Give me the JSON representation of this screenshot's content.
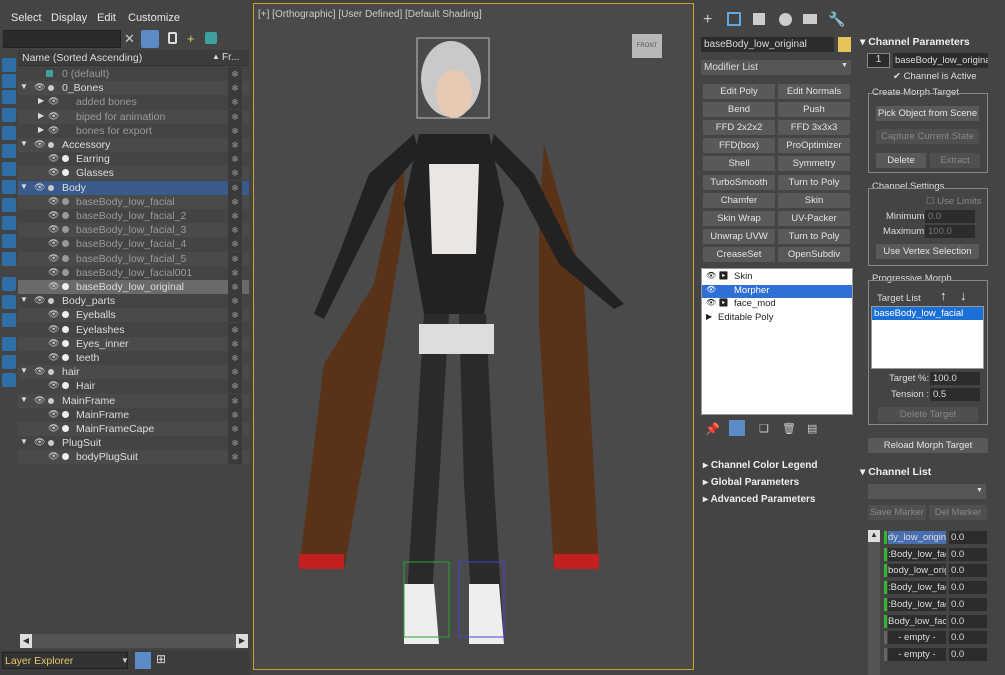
{
  "menu": {
    "select": "Select",
    "display": "Display",
    "edit": "Edit",
    "customize": "Customize"
  },
  "scene": {
    "header_name": "Name (Sorted Ascending)",
    "header_col": "Fr...",
    "rows": [
      "0 (default)",
      "0_Bones",
      "added bones",
      "biped for animation",
      "bones for export",
      "Accessory",
      "Earring",
      "Glasses",
      "Body",
      "baseBody_low_facial",
      "baseBody_low_facial_2",
      "baseBody_low_facial_3",
      "baseBody_low_facial_4",
      "baseBody_low_facial_5",
      "baseBody_low_facial001",
      "baseBody_low_original",
      "Body_parts",
      "Eyeballs",
      "Eyelashes",
      "Eyes_inner",
      "teeth",
      "hair",
      "Hair",
      "MainFrame",
      "MainFrame",
      "MainFrameCape",
      "PlugSuit",
      "bodyPlugSuit"
    ],
    "explorer": "Layer Explorer"
  },
  "viewport": {
    "label": "[+] [Orthographic] [User Defined] [Default Shading]",
    "cube": "FRONT"
  },
  "modify": {
    "object_name": "baseBody_low_original",
    "modifier_list": "Modifier List",
    "buttons": [
      "Edit Poly",
      "Edit Normals",
      "Bend",
      "Push",
      "FFD 2x2x2",
      "FFD 3x3x3",
      "FFD(box)",
      "ProOptimizer",
      "Shell",
      "Symmetry",
      "TurboSmooth",
      "Turn to Poly",
      "Chamfer",
      "Skin",
      "Skin Wrap",
      "UV-Packer",
      "Unwrap UVW",
      "Turn to Poly",
      "CreaseSet",
      "OpenSubdiv"
    ],
    "stack": [
      "Skin",
      "Morpher",
      "face_mod",
      "Editable Poly"
    ],
    "rollouts": [
      "Channel Color Legend",
      "Global Parameters",
      "Advanced Parameters"
    ]
  },
  "channel": {
    "title": "Channel Parameters",
    "index": "1",
    "name": "baseBody_low_original_",
    "active": "Channel is Active",
    "create_title": "Create Morph Target",
    "pick": "Pick Object from Scene",
    "capture": "Capture Current State",
    "delete": "Delete",
    "extract": "Extract",
    "settings_title": "Channel Settings",
    "use_limits": "Use Limits",
    "min_lbl": "Minimum :",
    "min_val": "0.0",
    "max_lbl": "Maximum :",
    "max_val": "100.0",
    "vertex_sel": "Use Vertex Selection",
    "prog_title": "Progressive Morph",
    "target_list": "Target List",
    "target_item": "baseBody_low_facial",
    "target_pct_lbl": "Target %:",
    "target_pct": "100.0",
    "tension_lbl": "Tension :",
    "tension": "0.5",
    "delete_target": "Delete Target",
    "reload": "Reload Morph Target",
    "list_title": "Channel List",
    "save_marker": "Save Marker",
    "del_marker": "Del Marker",
    "channels": [
      {
        "name": "dy_low_origina",
        "val": "0.0"
      },
      {
        "name": ":Body_low_faci",
        "val": "0.0"
      },
      {
        "name": "body_low_origin",
        "val": "0.0"
      },
      {
        "name": ":Body_low_faci",
        "val": "0.0"
      },
      {
        "name": ":Body_low_faci",
        "val": "0.0"
      },
      {
        "name": "Body_low_facia",
        "val": "0.0"
      },
      {
        "name": "- empty -",
        "val": "0.0"
      },
      {
        "name": "- empty -",
        "val": "0.0"
      }
    ]
  }
}
